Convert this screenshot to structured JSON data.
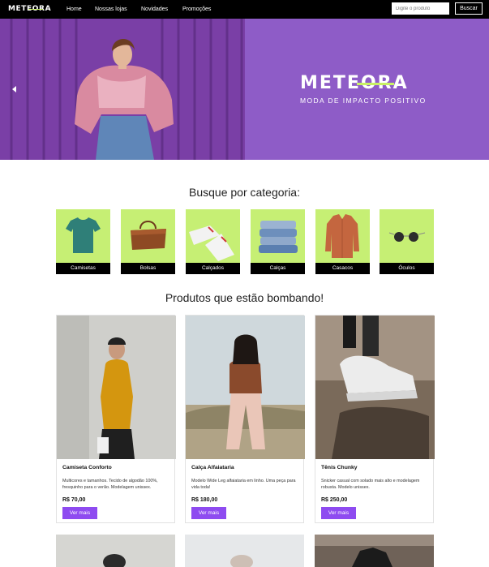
{
  "nav": {
    "logo": "METEORA",
    "links": [
      "Home",
      "Nossas lojas",
      "Novidades",
      "Promoções"
    ],
    "search_placeholder": "Digite o produto",
    "search_button": "Buscar"
  },
  "hero": {
    "brand": "METEORA",
    "tagline": "MODA DE IMPACTO POSITIVO"
  },
  "categories": {
    "title": "Busque por categoria:",
    "items": [
      "Camisetas",
      "Bolsas",
      "Calçados",
      "Calças",
      "Casacos",
      "Óculos"
    ]
  },
  "products": {
    "title": "Produtos que estão bombando!",
    "items": [
      {
        "name": "Camiseta Conforto",
        "description": "Multicores e tamanhos. Tecido de algodão 100%, fresquinho para o verão. Modelagem unissex.",
        "price": "R$ 70,00",
        "button": "Ver mais"
      },
      {
        "name": "Calça Alfaiataria",
        "description": "Modelo Wide Leg alfaiataria em linho. Uma peça para vida toda!",
        "price": "R$ 180,00",
        "button": "Ver mais"
      },
      {
        "name": "Tênis Chunky",
        "description": "Snicker casual com solado mais alto e modelagem robusta. Modelo unissex.",
        "price": "R$ 250,00",
        "button": "Ver mais"
      }
    ]
  },
  "colors": {
    "brand_purple": "#8e5cc7",
    "accent_green": "#c6ef74",
    "button_purple": "#8e4bf0"
  },
  "icons": {
    "hero_prev": "chevron-left-icon"
  }
}
